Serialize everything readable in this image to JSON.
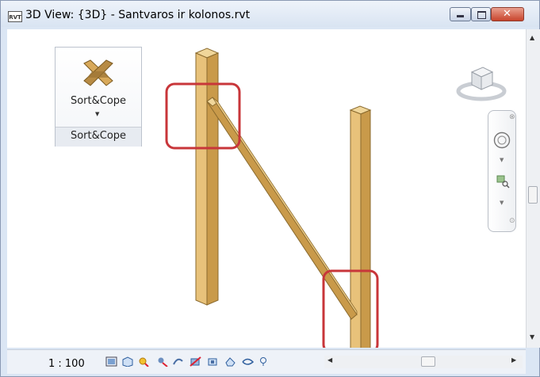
{
  "window": {
    "app_icon_text": "RVT",
    "title": "3D View: {3D} - Santvaros ir kolonos.rvt"
  },
  "panel": {
    "button_label": "Sort&Cope",
    "footer_label": "Sort&Cope"
  },
  "status": {
    "scale": "1 : 100"
  },
  "colors": {
    "wood": "#e8c27a",
    "wood_dark": "#b98a3d",
    "highlight": "#c8363a",
    "title_bar": "#d9e4f2"
  },
  "icons": [
    "sort-cope-icon",
    "viewcube-icon",
    "steering-wheel-icon",
    "zoom-icon",
    "visual-style-icon",
    "shadows-icon",
    "sun-path-icon",
    "crop-icon",
    "hide-icon",
    "reveal-icon",
    "lock-icon",
    "temp-hide-icon",
    "analytics-icon"
  ]
}
